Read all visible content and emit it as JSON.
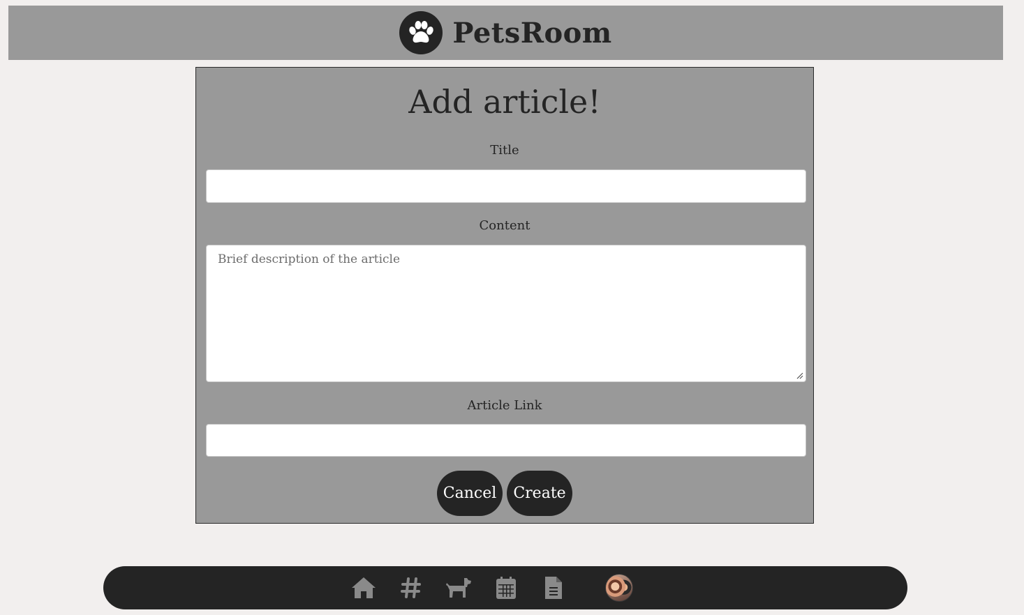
{
  "header": {
    "brand": "PetsRoom",
    "logo_icon": "paw-icon"
  },
  "form": {
    "title": "Add article!",
    "title_label": "Title",
    "title_value": "",
    "content_label": "Content",
    "content_placeholder": "Brief description of the article",
    "link_label": "Article Link",
    "link_value": "",
    "cancel_label": "Cancel",
    "create_label": "Create"
  },
  "nav": {
    "items": [
      {
        "icon": "home-icon"
      },
      {
        "icon": "hashtag-icon"
      },
      {
        "icon": "dog-icon"
      },
      {
        "icon": "calendar-icon"
      },
      {
        "icon": "document-icon"
      },
      {
        "icon": "avatar"
      }
    ]
  },
  "colors": {
    "background": "#f2efee",
    "panel": "#999999",
    "dark": "#242424",
    "nav_icon": "#8a8a8a"
  }
}
